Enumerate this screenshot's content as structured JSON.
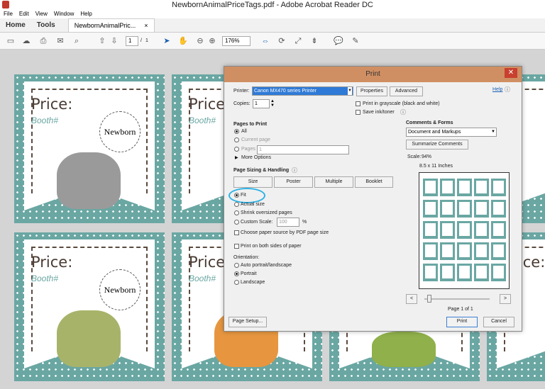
{
  "window": {
    "title": "NewbornAnimalPriceTags.pdf - Adobe Acrobat Reader DC"
  },
  "menu": [
    "File",
    "Edit",
    "View",
    "Window",
    "Help"
  ],
  "tabs": {
    "home": "Home",
    "tools": "Tools",
    "doc": "NewbornAnimalPric...",
    "doc_close": "×"
  },
  "toolbar": {
    "page_current": "1",
    "page_sep": "/",
    "page_total": "1",
    "zoom": "176%"
  },
  "tags": {
    "price": "Price:",
    "booth": "Booth#",
    "circle": "Newborn"
  },
  "dialog": {
    "title": "Print",
    "close": "✕",
    "help": "Help",
    "printer_label": "Printer:",
    "printer_value": "Canon MX470 series Printer",
    "properties": "Properties",
    "advanced": "Advanced",
    "copies_label": "Copies:",
    "copies_value": "1",
    "grayscale": "Print in grayscale (black and white)",
    "save_ink": "Save ink/toner",
    "pages_header": "Pages to Print",
    "all": "All",
    "current_page": "Current page",
    "pages": "Pages",
    "pages_value": "1",
    "more_options": "More Options",
    "sizing_header": "Page Sizing & Handling",
    "size_btn": "Size",
    "poster_btn": "Poster",
    "multiple_btn": "Multiple",
    "booklet_btn": "Booklet",
    "fit": "Fit",
    "actual_size": "Actual size",
    "shrink": "Shrink oversized pages",
    "custom_scale": "Custom Scale:",
    "custom_scale_value": "100",
    "percent": "%",
    "choose_paper": "Choose paper source by PDF page size",
    "both_sides": "Print on both sides of paper",
    "orientation_label": "Orientation:",
    "auto_orient": "Auto portrait/landscape",
    "portrait": "Portrait",
    "landscape": "Landscape",
    "comments_header": "Comments & Forms",
    "comments_value": "Document and Markups",
    "summarize": "Summarize Comments",
    "scale_label": "Scale:",
    "scale_value": "94%",
    "paper_size": "8.5 x 11 Inches",
    "prev": "<",
    "next": ">",
    "page_of": "Page 1 of 1",
    "page_setup": "Page Setup...",
    "print": "Print",
    "cancel": "Cancel"
  }
}
